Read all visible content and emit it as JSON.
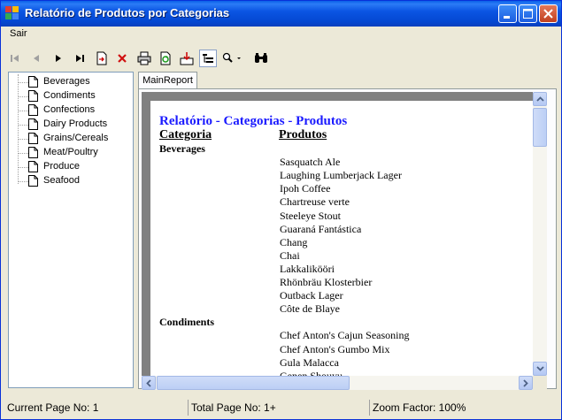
{
  "window": {
    "title": "Relatório de Produtos por Categorias",
    "caption_buttons": [
      "minimize",
      "maximize",
      "close"
    ]
  },
  "menu": {
    "items": [
      {
        "label": "Sair"
      }
    ]
  },
  "toolbar": {
    "buttons": [
      {
        "icon": "first-page-icon",
        "enabled": false
      },
      {
        "icon": "previous-page-icon",
        "enabled": false
      },
      {
        "icon": "next-page-icon",
        "enabled": true
      },
      {
        "icon": "last-page-icon",
        "enabled": true
      },
      {
        "icon": "goto-page-icon",
        "enabled": true
      },
      {
        "icon": "stop-icon",
        "enabled": true
      },
      {
        "icon": "print-icon",
        "enabled": true
      },
      {
        "icon": "refresh-icon",
        "enabled": true
      },
      {
        "icon": "export-icon",
        "enabled": true
      },
      {
        "icon": "group-tree-icon",
        "enabled": true,
        "pressed": true
      },
      {
        "icon": "zoom-icon",
        "enabled": true
      },
      {
        "icon": "search-icon",
        "enabled": true
      }
    ]
  },
  "group_tree": {
    "items": [
      {
        "label": "Beverages"
      },
      {
        "label": "Condiments"
      },
      {
        "label": "Confections"
      },
      {
        "label": "Dairy Products"
      },
      {
        "label": "Grains/Cereals"
      },
      {
        "label": "Meat/Poultry"
      },
      {
        "label": "Produce"
      },
      {
        "label": "Seafood"
      }
    ]
  },
  "tabs": [
    {
      "label": "MainReport"
    }
  ],
  "report": {
    "title": "Relatório - Categorias - Produtos",
    "header_category": "Categoria",
    "header_products": "Produtos",
    "groups": [
      {
        "category": "Beverages",
        "products": [
          "Sasquatch Ale",
          "Laughing Lumberjack Lager",
          "Ipoh Coffee",
          "Chartreuse verte",
          "Steeleye Stout",
          "Guaraná Fantástica",
          "Chang",
          "Chai",
          "Lakkalikööri",
          "Rhönbräu Klosterbier",
          "Outback Lager",
          "Côte de Blaye"
        ]
      },
      {
        "category": "Condiments",
        "products": [
          "Chef Anton's Cajun Seasoning",
          "Chef Anton's Gumbo Mix",
          "Gula Malacca",
          "Genen Shouyu"
        ]
      }
    ]
  },
  "scrollbars": {
    "vertical": {
      "position_fraction": 0.05
    },
    "horizontal": {
      "position_fraction": 0.0
    }
  },
  "status": {
    "current_page": "Current Page No: 1",
    "total_pages": "Total Page No: 1+",
    "zoom": "Zoom Factor: 100%"
  },
  "colors": {
    "titlebar": "#0a5fe8",
    "report_title": "#1a1aff",
    "close_button": "#c0401f"
  }
}
